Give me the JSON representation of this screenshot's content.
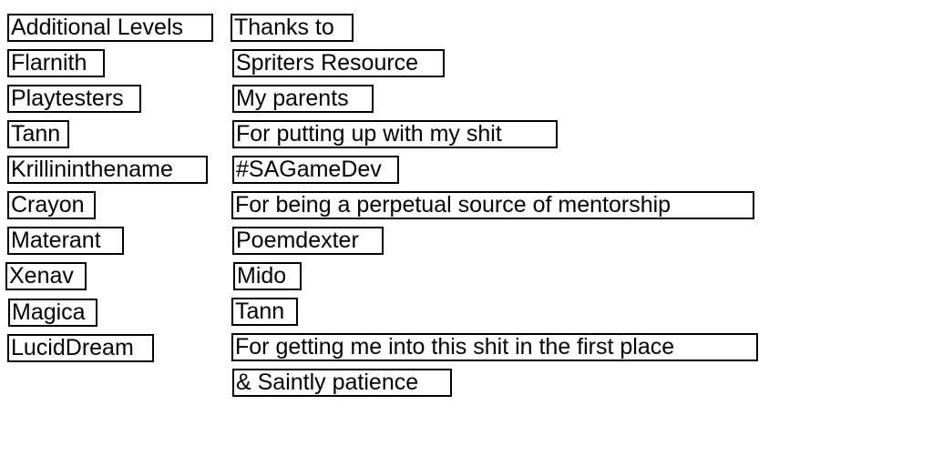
{
  "credits": {
    "left": [
      "Additional Levels",
      "Flarnith",
      "Playtesters",
      "Tann",
      "Krillininthename",
      "Crayon",
      "Materant",
      "Xenav",
      "Magica",
      "LucidDream"
    ],
    "right": [
      "Thanks to",
      "Spriters Resource",
      "My parents",
      "For putting up with my shit",
      "#SAGameDev",
      "For being a perpetual source of mentorship",
      "Poemdexter",
      "Mido",
      "Tann",
      "For getting me into this shit in the first place",
      "& Saintly patience"
    ]
  }
}
